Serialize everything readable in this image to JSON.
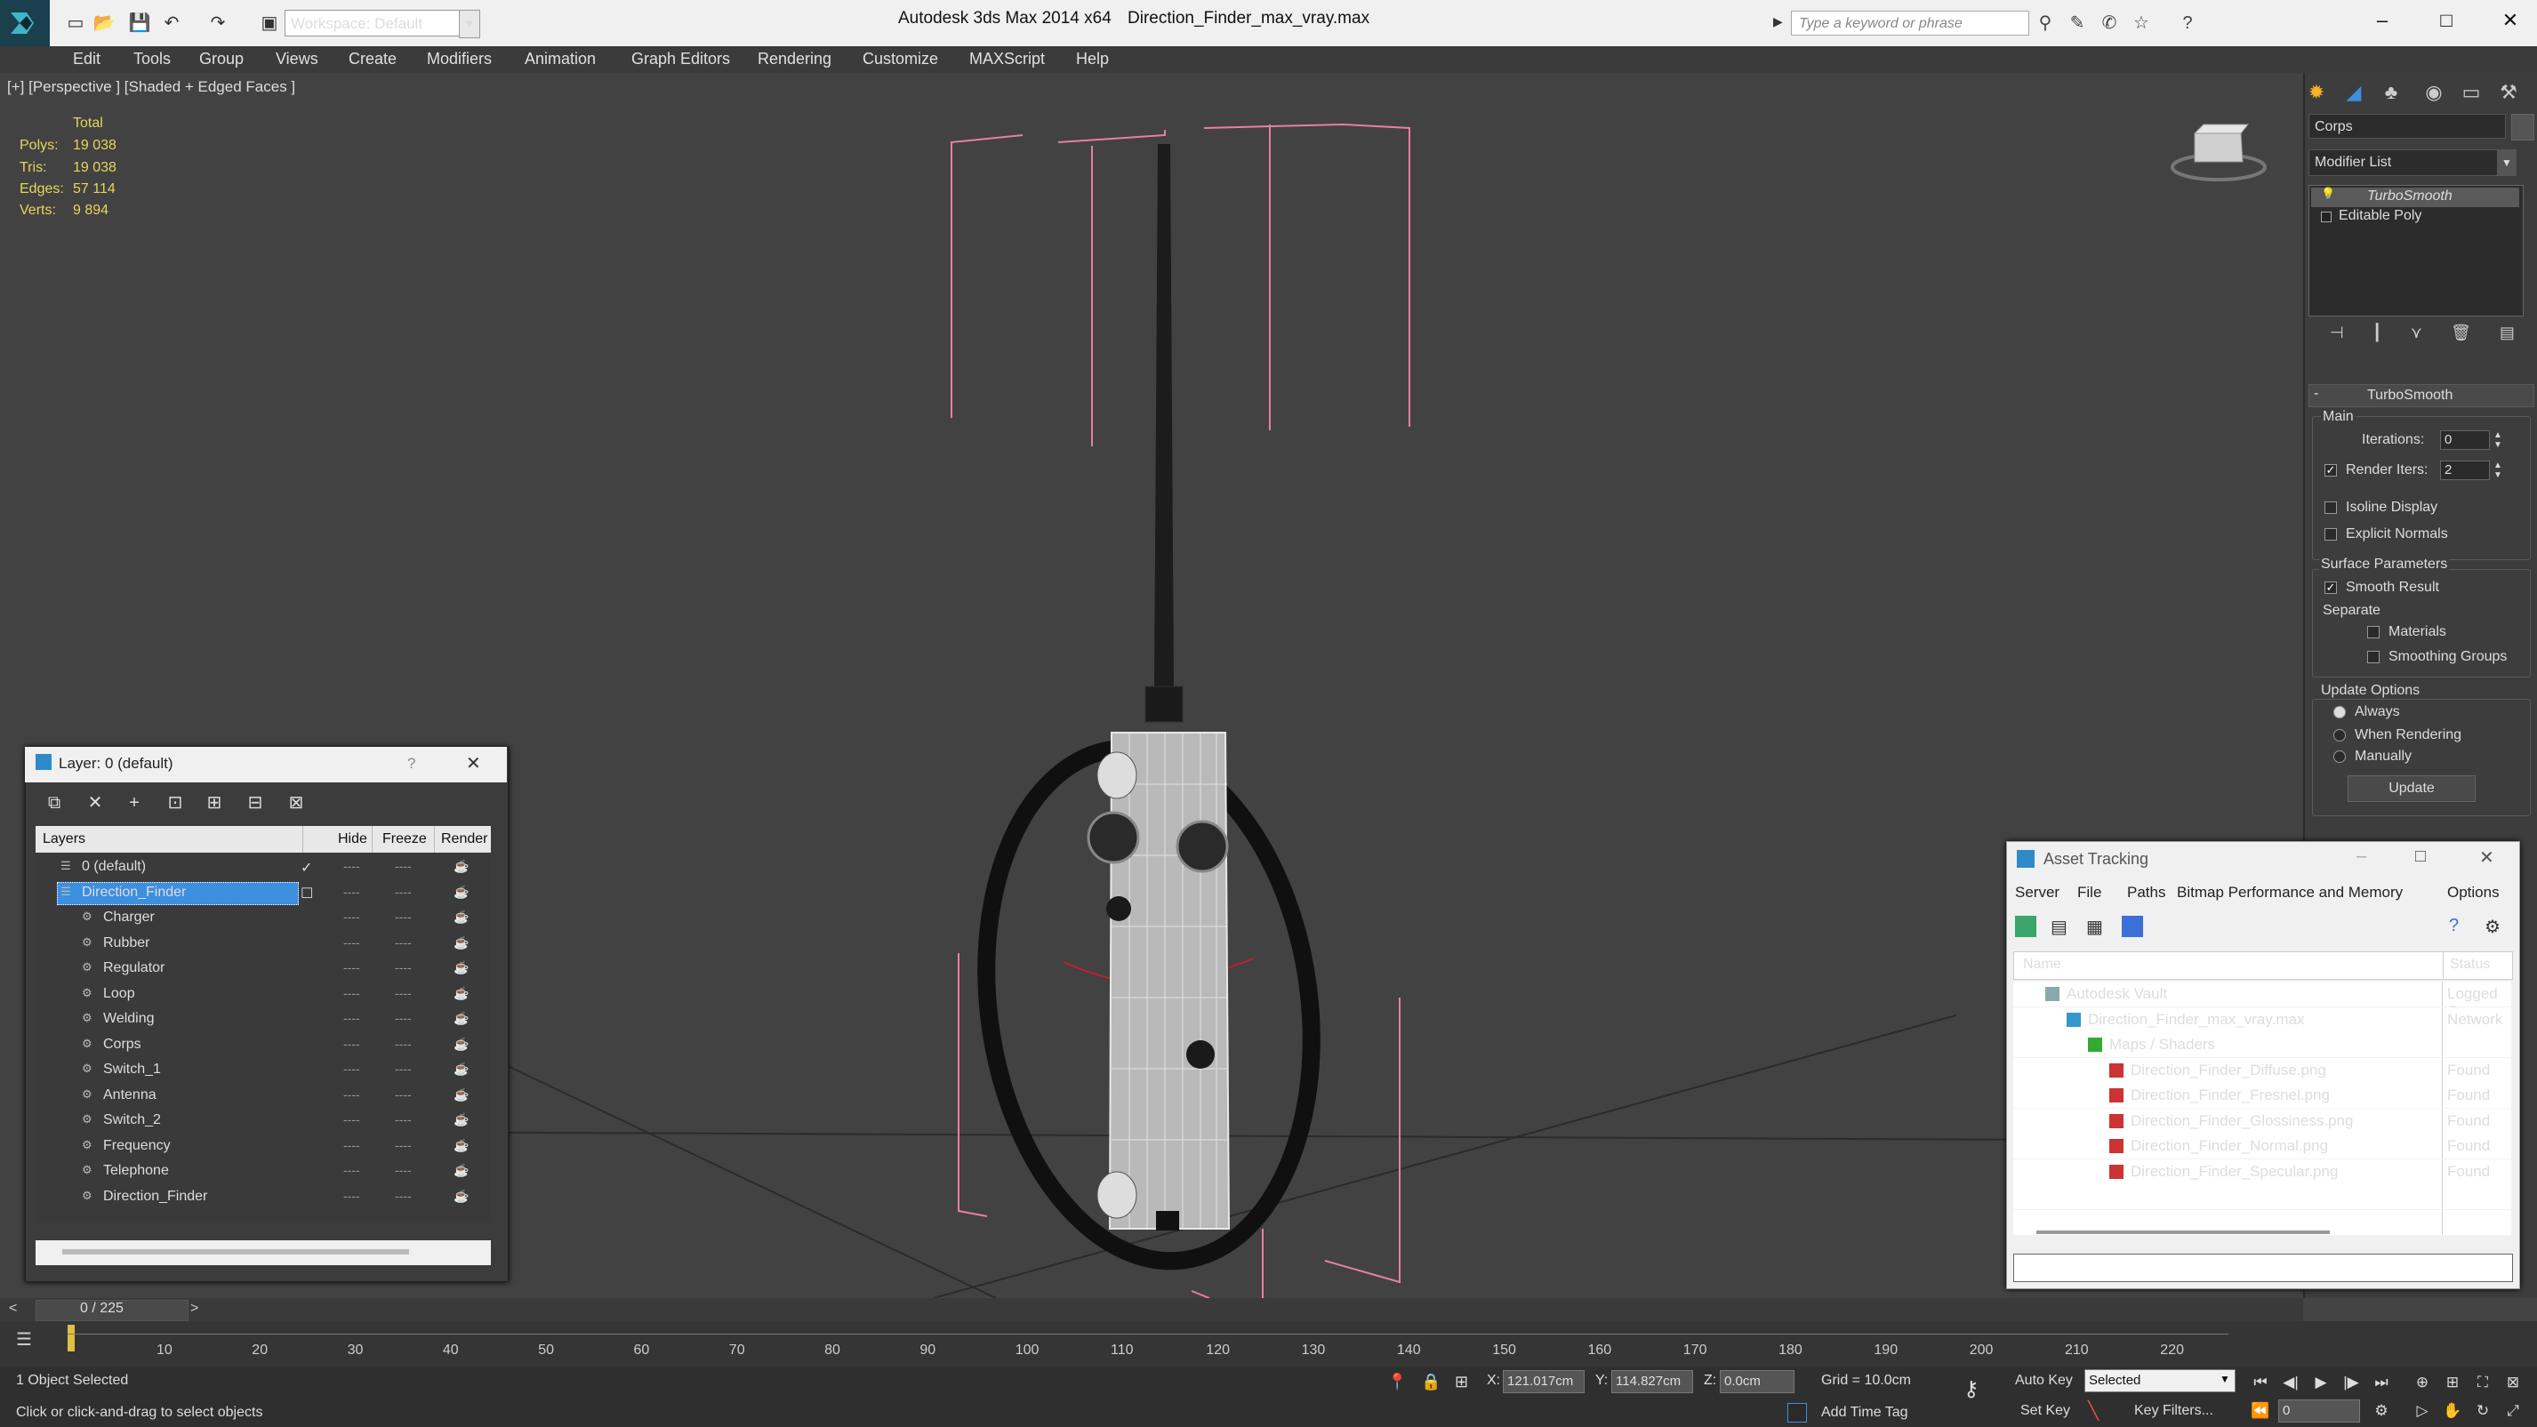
{
  "titlebar": {
    "app_title": "Autodesk 3ds Max  2014 x64",
    "file_title": "Direction_Finder_max_vray.max",
    "workspace": "Workspace: Default",
    "search_placeholder": "Type a keyword or phrase"
  },
  "menu": [
    "Edit",
    "Tools",
    "Group",
    "Views",
    "Create",
    "Modifiers",
    "Animation",
    "Graph Editors",
    "Rendering",
    "Customize",
    "MAXScript",
    "Help"
  ],
  "viewport": {
    "label": "[+] [Perspective ] [Shaded + Edged Faces ]",
    "stats_header": "Total",
    "stats": [
      {
        "label": "Polys:",
        "value": "19 038"
      },
      {
        "label": "Tris:",
        "value": "19 038"
      },
      {
        "label": "Edges:",
        "value": "57 114"
      },
      {
        "label": "Verts:",
        "value": "9 894"
      }
    ]
  },
  "command_panel": {
    "object_name": "Corps",
    "modifier_list": "Modifier List",
    "stack": [
      "TurboSmooth",
      "Editable Poly"
    ],
    "rollout_title": "TurboSmooth",
    "main_label": "Main",
    "iterations_label": "Iterations:",
    "iterations_value": "0",
    "render_iters_label": "Render Iters:",
    "render_iters_value": "2",
    "isoline": "Isoline Display",
    "explicit_normals": "Explicit Normals",
    "surface_params": "Surface Parameters",
    "smooth_result": "Smooth Result",
    "separate": "Separate",
    "materials": "Materials",
    "smoothing_groups": "Smoothing Groups",
    "update_options": "Update Options",
    "always": "Always",
    "when_rendering": "When Rendering",
    "manually": "Manually",
    "update_button": "Update"
  },
  "layer_dialog": {
    "title": "Layer: 0 (default)",
    "help": "?",
    "columns": {
      "layers": "Layers",
      "hide": "Hide",
      "freeze": "Freeze",
      "render": "Render"
    },
    "rows": [
      {
        "name": "0 (default)",
        "indent": 0
      },
      {
        "name": "Direction_Finder",
        "indent": 0,
        "selected": true
      },
      {
        "name": "Charger",
        "indent": 1
      },
      {
        "name": "Rubber",
        "indent": 1
      },
      {
        "name": "Regulator",
        "indent": 1
      },
      {
        "name": "Loop",
        "indent": 1
      },
      {
        "name": "Welding",
        "indent": 1
      },
      {
        "name": "Corps",
        "indent": 1
      },
      {
        "name": "Switch_1",
        "indent": 1
      },
      {
        "name": "Antenna",
        "indent": 1
      },
      {
        "name": "Switch_2",
        "indent": 1
      },
      {
        "name": "Frequency",
        "indent": 1
      },
      {
        "name": "Telephone",
        "indent": 1
      },
      {
        "name": "Direction_Finder",
        "indent": 1
      }
    ],
    "dash": "----"
  },
  "asset_tracking": {
    "title": "Asset Tracking",
    "menu": [
      "Server",
      "File",
      "Paths",
      "Bitmap Performance and Memory",
      "Options"
    ],
    "columns": {
      "name": "Name",
      "status": "Status"
    },
    "rows": [
      {
        "name": "Autodesk Vault",
        "status": "Logged O",
        "indent": 0
      },
      {
        "name": "Direction_Finder_max_vray.max",
        "status": "Network",
        "indent": 1
      },
      {
        "name": "Maps / Shaders",
        "status": "",
        "indent": 2
      },
      {
        "name": "Direction_Finder_Diffuse.png",
        "status": "Found",
        "indent": 3
      },
      {
        "name": "Direction_Finder_Fresnel.png",
        "status": "Found",
        "indent": 3
      },
      {
        "name": "Direction_Finder_Glossiness.png",
        "status": "Found",
        "indent": 3
      },
      {
        "name": "Direction_Finder_Normal.png",
        "status": "Found",
        "indent": 3
      },
      {
        "name": "Direction_Finder_Specular.png",
        "status": "Found",
        "indent": 3
      }
    ]
  },
  "timeline": {
    "frame": "0 / 225",
    "ticks": [
      "10",
      "20",
      "30",
      "40",
      "50",
      "60",
      "70",
      "80",
      "90",
      "100",
      "110",
      "120",
      "130",
      "140",
      "150",
      "160",
      "170",
      "180",
      "190",
      "200",
      "210",
      "220"
    ]
  },
  "status": {
    "selected": "1 Object Selected",
    "hint": "Click or click-and-drag to select objects",
    "x_label": "X:",
    "x_value": "121.017cm",
    "y_label": "Y:",
    "y_value": "114.827cm",
    "z_label": "Z:",
    "z_value": "0.0cm",
    "grid": "Grid = 10.0cm",
    "auto_key": "Auto Key",
    "selected_set": "Selected",
    "set_key": "Set Key",
    "key_filters": "Key Filters...",
    "add_time_tag": "Add Time Tag",
    "frame_field": "0"
  },
  "colors": {
    "accent_blue": "#3d8fe0",
    "stat_yellow": "#e6d65a",
    "bbox_pink": "#e87fa3"
  }
}
